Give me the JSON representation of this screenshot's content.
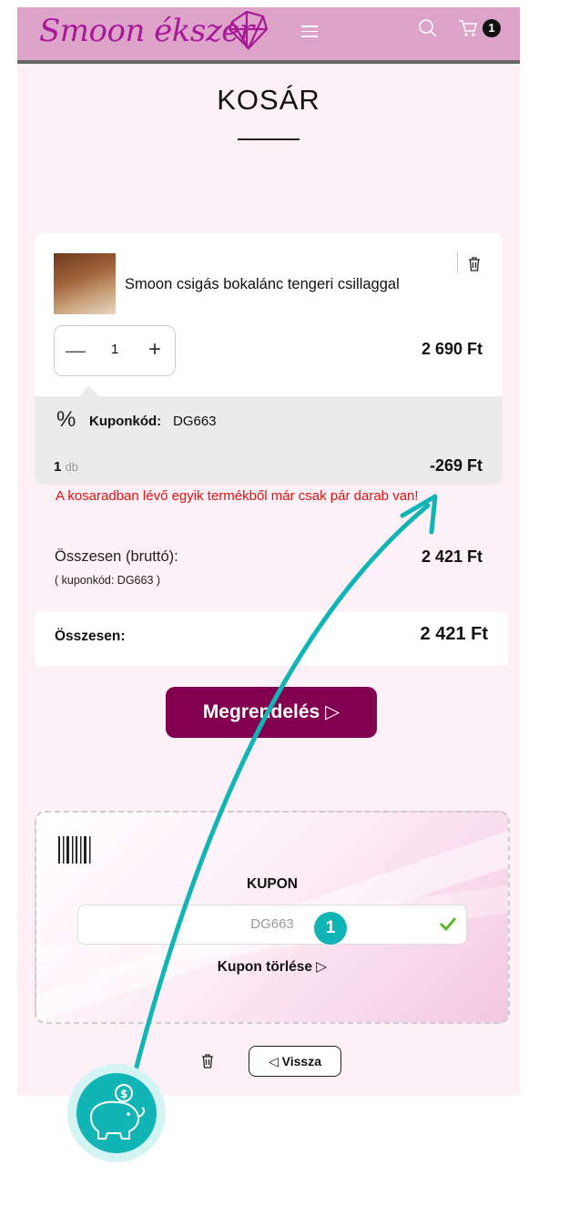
{
  "header": {
    "logo_text": "Smoon ékszer",
    "cart_count": "1"
  },
  "page_title": "KOSÁR",
  "cart_item": {
    "name": "Smoon csigás bokalánc tengeri csillaggal",
    "quantity": "1",
    "price": "2 690 Ft",
    "coupon": {
      "label": "Kuponkód:",
      "code": "DG663",
      "qty": "1",
      "unit": "db",
      "discount": "-269 Ft"
    }
  },
  "warning": "A kosaradban lévő egyik termékből már csak pár darab van!",
  "summary": {
    "subtotal_label": "Összesen (bruttó):",
    "subtotal_note": "( kuponkód: DG663 )",
    "subtotal_value": "2 421 Ft",
    "total_label": "Összesen:",
    "total_value": "2 421 Ft"
  },
  "order_button": "Megrendelés ▷",
  "kupon_panel": {
    "title": "KUPON",
    "input_value": "DG663",
    "delete_link": "Kupon törlése ▷"
  },
  "back_button": "◁ Vissza",
  "annotation": {
    "step": "1"
  },
  "colors": {
    "header_bg": "#dda3c8",
    "logo": "#a8199a",
    "order_button": "#830050",
    "warning": "#e8120d",
    "annotation": "#11b5b5",
    "check": "#5cb82e"
  }
}
